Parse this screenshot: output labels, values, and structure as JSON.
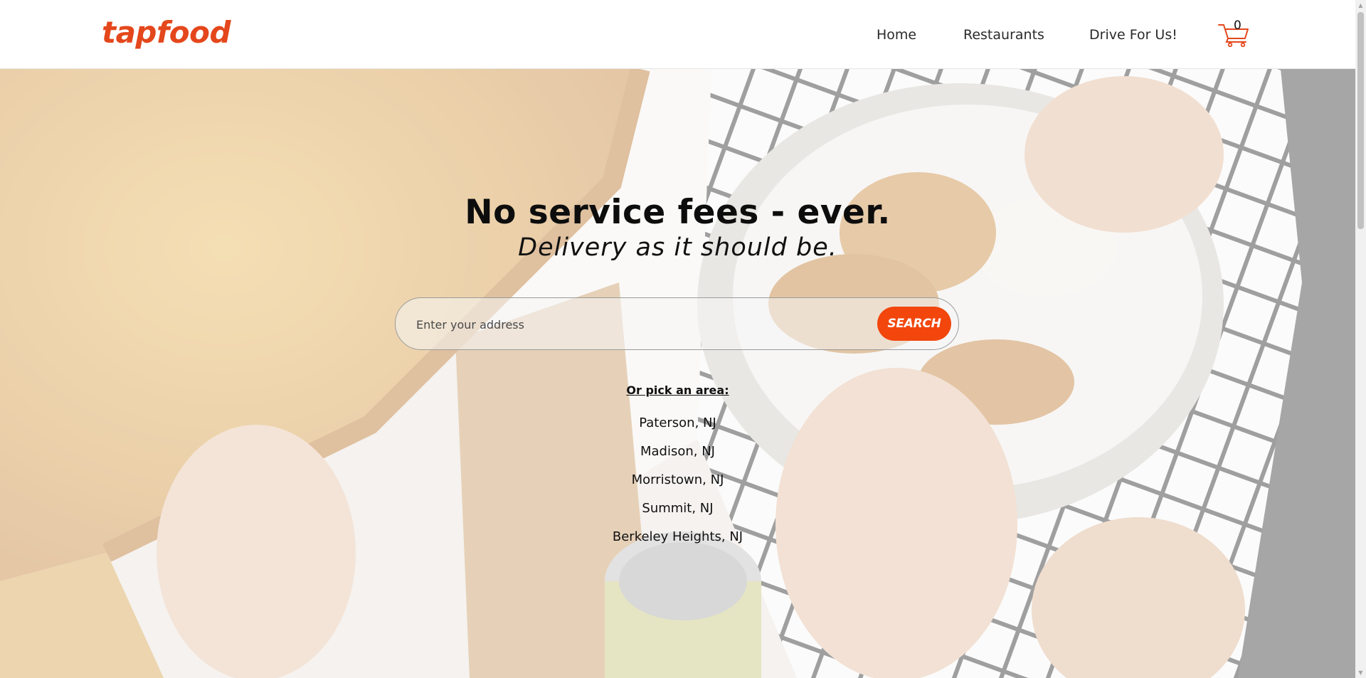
{
  "header": {
    "logo": "tapfood",
    "nav": [
      {
        "label": "Home"
      },
      {
        "label": "Restaurants"
      },
      {
        "label": "Drive For Us!"
      }
    ],
    "cart_count": "0",
    "brand_color": "#e4471c"
  },
  "hero": {
    "headline": "No service fees - ever.",
    "subheadline": "Delivery as it should be.",
    "search": {
      "placeholder": "Enter your address",
      "value": "",
      "button_label": "SEARCH",
      "button_color": "#f2460d"
    },
    "area_heading": "Or pick an area:",
    "areas": [
      "Paterson, NJ",
      "Madison, NJ",
      "Morristown, NJ",
      "Summit, NJ",
      "Berkeley Heights, NJ"
    ]
  }
}
